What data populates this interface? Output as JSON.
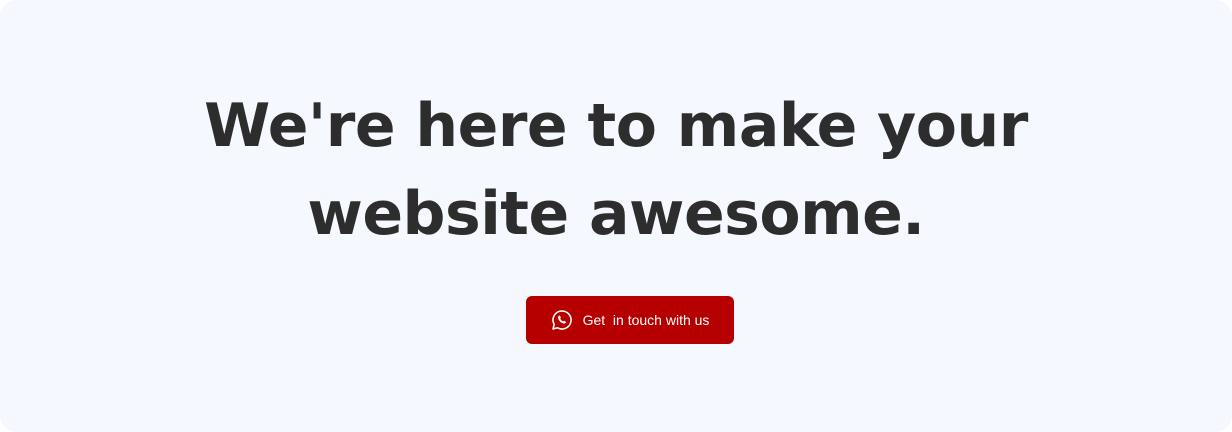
{
  "hero": {
    "line1": "We're here to make your",
    "line2": "website awesome.",
    "cta_label": "Get  in touch with us",
    "cta_icon": "whatsapp-icon"
  },
  "colors": {
    "background": "#f5f9ff",
    "heading": "#2d2d2d",
    "accent": "#b60000",
    "button_text": "#ffffff"
  }
}
